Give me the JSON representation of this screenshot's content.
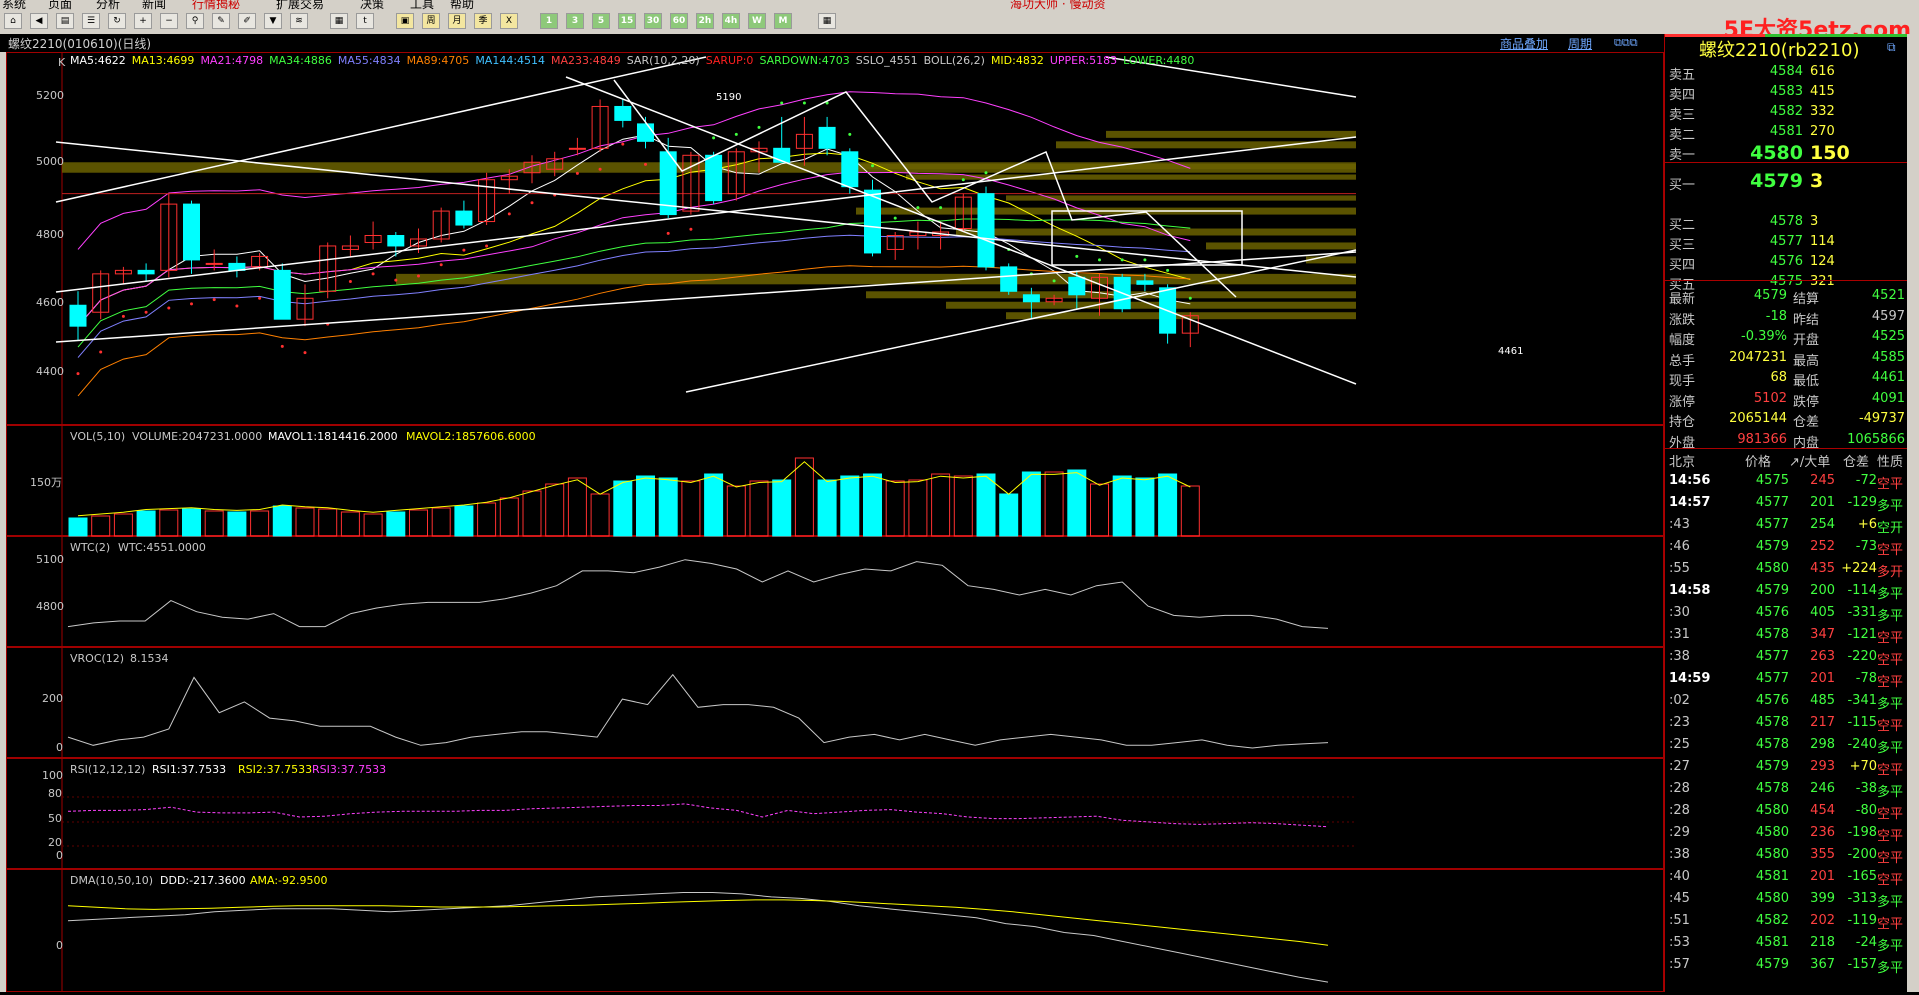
{
  "menu": {
    "items": [
      "系统",
      "页面",
      "分析",
      "新闻",
      "行情揭秘",
      "扩展交易",
      "决策",
      "工具",
      "帮助"
    ],
    "center": "海功大师 · 慢动资"
  },
  "toolbar": {
    "labels": [
      "1",
      "3",
      "5",
      "15",
      "30",
      "60",
      "2h",
      "4h",
      "W",
      "M"
    ],
    "watermark": "5E大资5etz.com"
  },
  "chart": {
    "title": "螺纹2210(010610)(日线)",
    "links": [
      "商品叠加",
      "周期"
    ],
    "main": {
      "label": "K",
      "indicators": [
        {
          "text": "MA5:4622",
          "color": "#ffffff"
        },
        {
          "text": "MA13:4699",
          "color": "#ffff00"
        },
        {
          "text": "MA21:4798",
          "color": "#ff40ff"
        },
        {
          "text": "MA34:4886",
          "color": "#40ff40"
        },
        {
          "text": "MA55:4834",
          "color": "#8080ff"
        },
        {
          "text": "MA89:4705",
          "color": "#ff8000"
        },
        {
          "text": "MA144:4514",
          "color": "#40c0ff"
        },
        {
          "text": "MA233:4849",
          "color": "#ff4040"
        },
        {
          "text": "SAR(10,2,20)",
          "color": "#c8c8c8"
        },
        {
          "text": "SARUP:0",
          "color": "#ff2020"
        },
        {
          "text": "SARDOWN:4703",
          "color": "#40ff40"
        },
        {
          "text": "SSLO_4551",
          "color": "#c8c8c8"
        },
        {
          "text": "BOLL(26,2)",
          "color": "#c8c8c8"
        },
        {
          "text": "MID:4832",
          "color": "#ffff00"
        },
        {
          "text": "UPPER:5183",
          "color": "#ff40ff"
        },
        {
          "text": "LOWER:4480",
          "color": "#40ff40"
        }
      ],
      "yticks": [
        "5200",
        "5000",
        "4800",
        "4600",
        "4400"
      ],
      "high_label": "5190",
      "low_label": "4461"
    },
    "vol": {
      "label": "VOL(5,10)",
      "v": "VOLUME:2047231.0000",
      "m1": "MAVOL1:1814416.2000",
      "m2": "MAVOL2:1857606.6000",
      "ytick": "150万"
    },
    "wtc": {
      "label": "WTC(2)",
      "v": "WTC:4551.0000",
      "yticks": [
        "5100",
        "4800"
      ]
    },
    "vroc": {
      "label": "VROC(12)",
      "v": "8.1534",
      "yticks": [
        "200",
        "0"
      ]
    },
    "rsi": {
      "label": "RSI(12,12,12)",
      "r1": "RSI1:37.7533",
      "r2": "RSI2:37.7533",
      "r3": "RSI3:37.7533",
      "yticks": [
        "100",
        "80",
        "50",
        "20",
        "0"
      ]
    },
    "dma": {
      "label": "DMA(10,50,10)",
      "d": "DDD:-217.3600",
      "a": "AMA:-92.9500",
      "ytick": "0"
    }
  },
  "chart_data": {
    "type": "candlestick",
    "candles_ohlc": [
      [
        4600,
        4640,
        4500,
        4540
      ],
      [
        4580,
        4700,
        4560,
        4690
      ],
      [
        4690,
        4710,
        4660,
        4700
      ],
      [
        4700,
        4720,
        4670,
        4690
      ],
      [
        4700,
        4920,
        4680,
        4890
      ],
      [
        4890,
        4900,
        4690,
        4730
      ],
      [
        4720,
        4760,
        4700,
        4720
      ],
      [
        4720,
        4740,
        4680,
        4700
      ],
      [
        4710,
        4750,
        4700,
        4740
      ],
      [
        4700,
        4720,
        4560,
        4560
      ],
      [
        4560,
        4660,
        4540,
        4620
      ],
      [
        4640,
        4780,
        4620,
        4770
      ],
      [
        4760,
        4800,
        4740,
        4770
      ],
      [
        4780,
        4840,
        4760,
        4800
      ],
      [
        4800,
        4810,
        4740,
        4770
      ],
      [
        4770,
        4820,
        4750,
        4790
      ],
      [
        4790,
        4880,
        4780,
        4870
      ],
      [
        4870,
        4900,
        4820,
        4830
      ],
      [
        4840,
        4980,
        4830,
        4960
      ],
      [
        4960,
        4990,
        4920,
        4970
      ],
      [
        4980,
        5030,
        4950,
        5010
      ],
      [
        4990,
        5040,
        4970,
        5020
      ],
      [
        5050,
        5080,
        5030,
        5050
      ],
      [
        5050,
        5190,
        5040,
        5170
      ],
      [
        5170,
        5190,
        5110,
        5130
      ],
      [
        5120,
        5140,
        5050,
        5070
      ],
      [
        5040,
        5080,
        4850,
        4860
      ],
      [
        4870,
        5040,
        4860,
        5030
      ],
      [
        5030,
        5040,
        4890,
        4900
      ],
      [
        4920,
        5050,
        4900,
        5040
      ],
      [
        5040,
        5070,
        4980,
        5050
      ],
      [
        5050,
        5140,
        5030,
        5010
      ],
      [
        5050,
        5140,
        5000,
        5090
      ],
      [
        5110,
        5140,
        5030,
        5050
      ],
      [
        5040,
        5050,
        4920,
        4940
      ],
      [
        4930,
        4960,
        4740,
        4750
      ],
      [
        4760,
        4810,
        4730,
        4800
      ],
      [
        4800,
        4840,
        4760,
        4810
      ],
      [
        4800,
        4840,
        4760,
        4810
      ],
      [
        4820,
        4920,
        4810,
        4910
      ],
      [
        4920,
        4940,
        4700,
        4710
      ],
      [
        4710,
        4720,
        4630,
        4640
      ],
      [
        4630,
        4650,
        4560,
        4610
      ],
      [
        4610,
        4630,
        4600,
        4620
      ],
      [
        4680,
        4700,
        4590,
        4630
      ],
      [
        4620,
        4690,
        4570,
        4680
      ],
      [
        4680,
        4690,
        4580,
        4590
      ],
      [
        4670,
        4690,
        4640,
        4660
      ],
      [
        4650,
        4660,
        4490,
        4520
      ],
      [
        4520,
        4580,
        4480,
        4570
      ]
    ],
    "moving_averages": [
      "MA5:4622",
      "MA13:4699",
      "MA21:4798",
      "MA34:4886",
      "MA55:4834",
      "MA89:4705",
      "MA144:4514",
      "MA233:4849"
    ],
    "boll": {
      "mid": 4832,
      "upper": 5183,
      "lower": 4480
    },
    "volume_relative": [
      0.18,
      0.2,
      0.22,
      0.25,
      0.26,
      0.27,
      0.25,
      0.24,
      0.25,
      0.3,
      0.28,
      0.27,
      0.24,
      0.22,
      0.24,
      0.26,
      0.28,
      0.3,
      0.33,
      0.38,
      0.45,
      0.52,
      0.58,
      0.42,
      0.55,
      0.6,
      0.58,
      0.55,
      0.62,
      0.5,
      0.55,
      0.56,
      0.78,
      0.56,
      0.6,
      0.62,
      0.55,
      0.56,
      0.62,
      0.6,
      0.62,
      0.42,
      0.64,
      0.64,
      0.66,
      0.52,
      0.6,
      0.58,
      0.62,
      0.5
    ],
    "wtc_values": [
      4740,
      4760,
      4770,
      4770,
      4880,
      4820,
      4790,
      4780,
      4810,
      4740,
      4740,
      4810,
      4840,
      4860,
      4870,
      4870,
      4870,
      4890,
      4920,
      4960,
      5040,
      5040,
      5030,
      5060,
      5100,
      5080,
      5050,
      4980,
      5040,
      4980,
      5020,
      5050,
      5040,
      5090,
      5070,
      4960,
      4940,
      4910,
      4940,
      4910,
      4960,
      4980,
      4850,
      4800,
      4790,
      4800,
      4800,
      4780,
      4740,
      4730
    ],
    "vroc_values": [
      40,
      10,
      30,
      40,
      70,
      260,
      130,
      170,
      110,
      100,
      80,
      80,
      80,
      40,
      10,
      20,
      40,
      50,
      60,
      60,
      50,
      40,
      180,
      160,
      270,
      150,
      160,
      160,
      150,
      110,
      20,
      40,
      50,
      30,
      50,
      30,
      10,
      30,
      40,
      50,
      40,
      30,
      10,
      10,
      20,
      30,
      10,
      0,
      10,
      15,
      20
    ],
    "rsi_values": [
      57,
      58,
      58,
      59,
      62,
      56,
      55,
      55,
      56,
      50,
      51,
      54,
      56,
      57,
      57,
      57,
      58,
      58,
      60,
      61,
      62,
      63,
      64,
      64,
      66,
      61,
      58,
      50,
      58,
      54,
      56,
      58,
      59,
      56,
      54,
      50,
      48,
      48,
      49,
      50,
      51,
      46,
      44,
      42,
      41,
      42,
      43,
      42,
      40,
      38
    ],
    "dma_ddd": [
      -10,
      -5,
      0,
      5,
      10,
      20,
      25,
      30,
      30,
      30,
      25,
      20,
      25,
      30,
      35,
      40,
      50,
      60,
      70,
      75,
      80,
      85,
      85,
      80,
      70,
      65,
      55,
      40,
      30,
      20,
      10,
      0,
      -20,
      -30,
      -50,
      -60,
      -80,
      -100,
      -120,
      -140,
      -160,
      -180,
      -200,
      -217
    ],
    "dma_ama": [
      40,
      35,
      30,
      28,
      30,
      32,
      35,
      38,
      40,
      40,
      40,
      40,
      38,
      36,
      36,
      36,
      38,
      40,
      42,
      45,
      48,
      52,
      55,
      58,
      60,
      60,
      58,
      55,
      50,
      45,
      40,
      35,
      28,
      20,
      10,
      0,
      -10,
      -20,
      -30,
      -40,
      -50,
      -60,
      -70,
      -80,
      -93
    ]
  },
  "quote": {
    "name": "螺纹2210(rb2210)",
    "asks": [
      {
        "label": "卖五",
        "price": "4584",
        "vol": "616"
      },
      {
        "label": "卖四",
        "price": "4583",
        "vol": "415"
      },
      {
        "label": "卖三",
        "price": "4582",
        "vol": "332"
      },
      {
        "label": "卖二",
        "price": "4581",
        "vol": "270"
      },
      {
        "label": "卖一",
        "price": "4580",
        "vol": "150"
      }
    ],
    "bids": [
      {
        "label": "买一",
        "price": "4579",
        "vol": "3"
      },
      {
        "label": "买二",
        "price": "4578",
        "vol": "3"
      },
      {
        "label": "买三",
        "price": "4577",
        "vol": "114"
      },
      {
        "label": "买四",
        "price": "4576",
        "vol": "124"
      },
      {
        "label": "买五",
        "price": "4575",
        "vol": "321"
      }
    ],
    "stats": [
      {
        "l1": "最新",
        "v1": "4579",
        "c1": "#40ff40",
        "l2": "结算",
        "v2": "4521",
        "c2": "#40ff40"
      },
      {
        "l1": "涨跌",
        "v1": "-18",
        "c1": "#40ff40",
        "l2": "昨结",
        "v2": "4597",
        "c2": "#c8c8c8"
      },
      {
        "l1": "幅度",
        "v1": "-0.39%",
        "c1": "#40ff40",
        "l2": "开盘",
        "v2": "4525",
        "c2": "#40ff40"
      },
      {
        "l1": "总手",
        "v1": "2047231",
        "c1": "#ffff40",
        "l2": "最高",
        "v2": "4585",
        "c2": "#40ff40"
      },
      {
        "l1": "现手",
        "v1": "68",
        "c1": "#ffff40",
        "l2": "最低",
        "v2": "4461",
        "c2": "#40ff40"
      },
      {
        "l1": "涨停",
        "v1": "5102",
        "c1": "#ff4040",
        "l2": "跌停",
        "v2": "4091",
        "c2": "#40ff40"
      },
      {
        "l1": "持仓",
        "v1": "2065144",
        "c1": "#ffff40",
        "l2": "仓差",
        "v2": "-49737",
        "c2": "#ffff40"
      },
      {
        "l1": "外盘",
        "v1": "981366",
        "c1": "#ff4040",
        "l2": "内盘",
        "v2": "1065866",
        "c2": "#40ff40"
      }
    ],
    "ticks_header": [
      "北京",
      "价格",
      "↗/大单",
      "仓差",
      "性质"
    ],
    "ticks": [
      {
        "t": "14:56",
        "p": "4575",
        "v": "245",
        "vc": "#ff4040",
        "c": "-72",
        "cc": "#40ff40",
        "n": "空平",
        "nc": "#ff4040"
      },
      {
        "t": "14:57",
        "p": "4577",
        "v": "201",
        "vc": "#40ff40",
        "c": "-129",
        "cc": "#40ff40",
        "n": "多平",
        "nc": "#40ff40"
      },
      {
        "t": ":43",
        "p": "4577",
        "v": "254",
        "vc": "#40ff40",
        "c": "+6",
        "cc": "#ffff40",
        "n": "空开",
        "nc": "#40ff40"
      },
      {
        "t": ":46",
        "p": "4579",
        "v": "252",
        "vc": "#ff4040",
        "c": "-73",
        "cc": "#40ff40",
        "n": "空平",
        "nc": "#ff4040"
      },
      {
        "t": ":55",
        "p": "4580",
        "v": "435",
        "vc": "#ff4040",
        "c": "+224",
        "cc": "#ffff40",
        "n": "多开",
        "nc": "#ff4040"
      },
      {
        "t": "14:58",
        "p": "4579",
        "v": "200",
        "vc": "#40ff40",
        "c": "-114",
        "cc": "#40ff40",
        "n": "多平",
        "nc": "#40ff40"
      },
      {
        "t": ":30",
        "p": "4576",
        "v": "405",
        "vc": "#40ff40",
        "c": "-331",
        "cc": "#40ff40",
        "n": "多平",
        "nc": "#40ff40"
      },
      {
        "t": ":31",
        "p": "4578",
        "v": "347",
        "vc": "#ff4040",
        "c": "-121",
        "cc": "#40ff40",
        "n": "空平",
        "nc": "#ff4040"
      },
      {
        "t": ":38",
        "p": "4577",
        "v": "263",
        "vc": "#ff4040",
        "c": "-220",
        "cc": "#40ff40",
        "n": "空平",
        "nc": "#ff4040"
      },
      {
        "t": "14:59",
        "p": "4577",
        "v": "201",
        "vc": "#ff4040",
        "c": "-78",
        "cc": "#40ff40",
        "n": "空平",
        "nc": "#ff4040"
      },
      {
        "t": ":02",
        "p": "4576",
        "v": "485",
        "vc": "#40ff40",
        "c": "-341",
        "cc": "#40ff40",
        "n": "多平",
        "nc": "#40ff40"
      },
      {
        "t": ":23",
        "p": "4578",
        "v": "217",
        "vc": "#ff4040",
        "c": "-115",
        "cc": "#40ff40",
        "n": "空平",
        "nc": "#ff4040"
      },
      {
        "t": ":25",
        "p": "4578",
        "v": "298",
        "vc": "#40ff40",
        "c": "-240",
        "cc": "#40ff40",
        "n": "多平",
        "nc": "#40ff40"
      },
      {
        "t": ":27",
        "p": "4579",
        "v": "293",
        "vc": "#ff4040",
        "c": "+70",
        "cc": "#ffff40",
        "n": "空平",
        "nc": "#ff4040"
      },
      {
        "t": ":28",
        "p": "4578",
        "v": "246",
        "vc": "#40ff40",
        "c": "-38",
        "cc": "#40ff40",
        "n": "多平",
        "nc": "#40ff40"
      },
      {
        "t": ":28",
        "p": "4580",
        "v": "454",
        "vc": "#ff4040",
        "c": "-80",
        "cc": "#40ff40",
        "n": "空平",
        "nc": "#ff4040"
      },
      {
        "t": ":29",
        "p": "4580",
        "v": "236",
        "vc": "#ff4040",
        "c": "-198",
        "cc": "#40ff40",
        "n": "空平",
        "nc": "#ff4040"
      },
      {
        "t": ":38",
        "p": "4580",
        "v": "355",
        "vc": "#ff4040",
        "c": "-200",
        "cc": "#40ff40",
        "n": "空平",
        "nc": "#ff4040"
      },
      {
        "t": ":40",
        "p": "4581",
        "v": "201",
        "vc": "#ff4040",
        "c": "-165",
        "cc": "#40ff40",
        "n": "空平",
        "nc": "#ff4040"
      },
      {
        "t": ":45",
        "p": "4580",
        "v": "399",
        "vc": "#40ff40",
        "c": "-313",
        "cc": "#40ff40",
        "n": "多平",
        "nc": "#40ff40"
      },
      {
        "t": ":51",
        "p": "4582",
        "v": "202",
        "vc": "#ff4040",
        "c": "-119",
        "cc": "#40ff40",
        "n": "空平",
        "nc": "#ff4040"
      },
      {
        "t": ":53",
        "p": "4581",
        "v": "218",
        "vc": "#40ff40",
        "c": "-24",
        "cc": "#40ff40",
        "n": "多平",
        "nc": "#40ff40"
      },
      {
        "t": ":57",
        "p": "4579",
        "v": "367",
        "vc": "#40ff40",
        "c": "-157",
        "cc": "#40ff40",
        "n": "多平",
        "nc": "#40ff40"
      }
    ]
  }
}
